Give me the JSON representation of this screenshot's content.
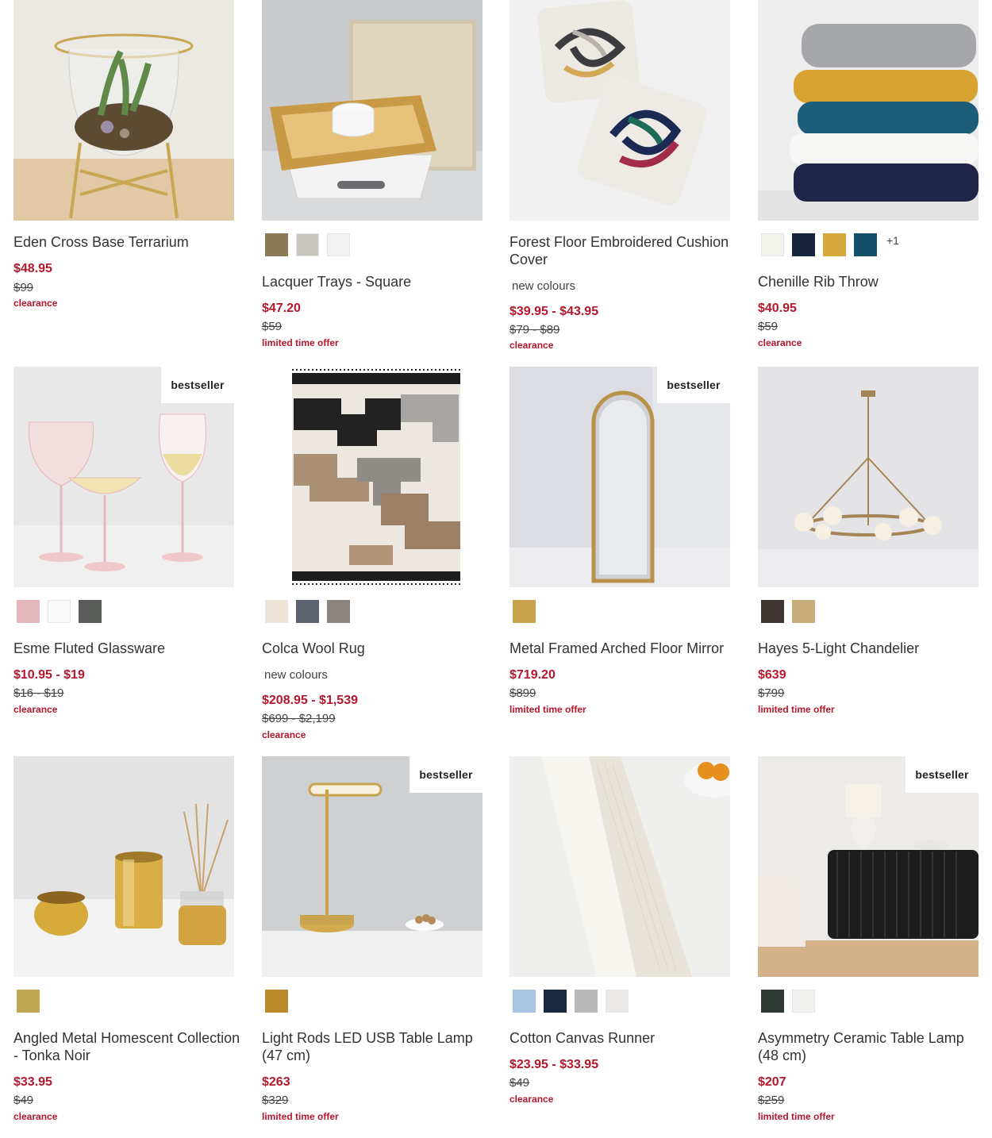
{
  "colors": {
    "sale": "#b5172d",
    "text": "#333333"
  },
  "products": [
    {
      "name": "Eden Cross Base Terrarium",
      "price": "$48.95",
      "was": "$99",
      "promo": "clearance",
      "swatches": []
    },
    {
      "name": "Lacquer Trays - Square",
      "price": "$47.20",
      "was": "$59",
      "promo": "limited time offer",
      "swatches": [
        "#8a7a55",
        "#c9c6c0",
        "#f2f2f2"
      ]
    },
    {
      "name": "Forest Floor Embroidered Cushion Cover",
      "tag": "new colours",
      "price": "$39.95 - $43.95",
      "was": "$79 - $89",
      "promo": "clearance",
      "swatches": []
    },
    {
      "name": "Chenille Rib Throw",
      "price": "$40.95",
      "was": "$59",
      "promo": "clearance",
      "swatches": [
        "#f3f3ee",
        "#17243a",
        "#d4a83a",
        "#14506a"
      ],
      "more": "+1"
    },
    {
      "name": "Esme Fluted Glassware",
      "badge": "bestseller",
      "price": "$10.95 - $19",
      "was": "$16 - $19",
      "promo": "clearance",
      "swatches": [
        "#e3b7bb",
        "#fafafa",
        "#5a5c5a"
      ]
    },
    {
      "name": "Colca Wool Rug",
      "tag": "new colours",
      "price": "$208.95 - $1,539",
      "was": "$699 - $2,199",
      "promo": "clearance",
      "swatches": [
        "#ede6d8",
        "#5d6170",
        "#8c857f"
      ]
    },
    {
      "name": "Metal Framed Arched Floor Mirror",
      "badge": "bestseller",
      "price": "$719.20",
      "was": "$899",
      "promo": "limited time offer",
      "swatches": [
        "#c9a24e"
      ]
    },
    {
      "name": "Hayes 5-Light Chandelier",
      "price": "$639",
      "was": "$799",
      "promo": "limited time offer",
      "swatches": [
        "#3d3632",
        "#c8ad7c"
      ]
    },
    {
      "name": "Angled Metal Homescent Collection - Tonka Noir",
      "price": "$33.95",
      "was": "$49",
      "promo": "clearance",
      "swatches": [
        "#c1a651"
      ]
    },
    {
      "name": "Light Rods LED USB Table Lamp (47 cm)",
      "badge": "bestseller",
      "price": "$263",
      "was": "$329",
      "promo": "limited time offer",
      "swatches": [
        "#b9892b"
      ]
    },
    {
      "name": "Cotton Canvas Runner",
      "price": "$23.95 - $33.95",
      "was": "$49",
      "promo": "clearance",
      "swatches": [
        "#a9c5e1",
        "#1a2840",
        "#b8b8b8",
        "#ece8e5"
      ]
    },
    {
      "name": "Asymmetry Ceramic Table Lamp (48 cm)",
      "badge": "bestseller",
      "price": "$207",
      "was": "$259",
      "promo": "limited time offer",
      "swatches": [
        "#2e3a33",
        "#f1f1f0"
      ]
    }
  ]
}
